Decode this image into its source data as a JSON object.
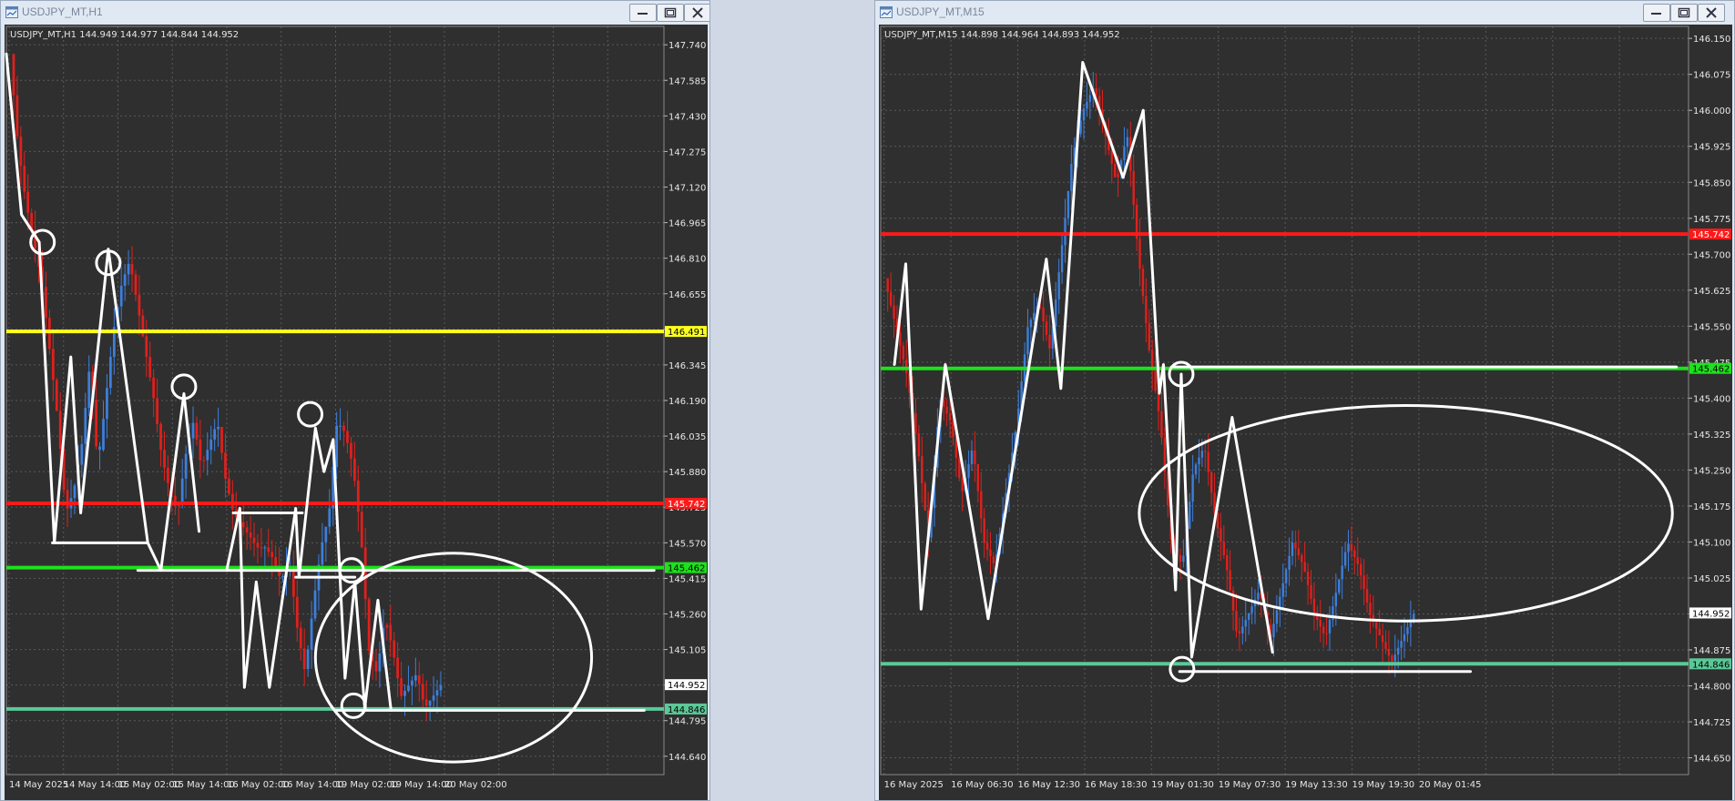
{
  "colors": {
    "bg": "#2f2f2f",
    "grid": "#5a5a5a",
    "axis_text": "#e6e6e6",
    "bull": "#3c7fdc",
    "bear": "#e0201c",
    "drawing": "#ffffff",
    "red_level": "#ff1a1a",
    "green_level": "#1ee11e",
    "teal_level": "#5cc898",
    "yellow_level": "#ffff1e"
  },
  "windows": [
    {
      "title": "USDJPY_MT,H1",
      "minimize_icon": "minimize-icon",
      "maximize_icon": "maximize-icon",
      "close_icon": "close-icon",
      "chart_data": {
        "type": "candlestick",
        "info_label": "USDJPY_MT,H1  144.949 144.977 144.844 144.952",
        "ylim": [
          144.56,
          147.82
        ],
        "y_ticks": [
          "147.740",
          "147.585",
          "147.430",
          "147.275",
          "147.120",
          "146.965",
          "146.810",
          "146.655",
          "146.500",
          "146.345",
          "146.190",
          "146.035",
          "145.880",
          "145.725",
          "145.570",
          "145.415",
          "145.260",
          "145.105",
          "144.950",
          "144.795",
          "144.640"
        ],
        "x_ticks": [
          "14 May 2025",
          "14 May 14:00",
          "15 May 02:00",
          "15 May 14:00",
          "16 May 02:00",
          "16 May 14:00",
          "19 May 02:00",
          "19 May 14:00",
          "20 May 02:00"
        ],
        "levels": [
          {
            "value": 146.491,
            "label": "146.491",
            "color": "#ffff1e"
          },
          {
            "value": 145.742,
            "label": "145.742",
            "color": "#ff1a1a"
          },
          {
            "value": 145.462,
            "label": "145.462",
            "color": "#1ee11e"
          },
          {
            "value": 144.846,
            "label": "144.846",
            "color": "#5cc898"
          }
        ],
        "current_price": "144.952",
        "current_value": 144.952,
        "candle_count": 120,
        "close_path": [
          147.7,
          147.3,
          147.05,
          146.88,
          146.7,
          146.4,
          146.1,
          145.7,
          145.8,
          146.0,
          146.35,
          145.9,
          146.2,
          146.5,
          146.7,
          146.8,
          146.6,
          146.4,
          146.2,
          145.95,
          145.8,
          145.7,
          145.95,
          146.1,
          145.9,
          146.0,
          146.1,
          145.85,
          145.7,
          145.65,
          145.6,
          145.55,
          145.55,
          145.5,
          145.4,
          145.5,
          145.2,
          145.0,
          145.3,
          145.55,
          145.7,
          146.1,
          146.05,
          145.9,
          145.6,
          145.1,
          145.0,
          145.25,
          145.1,
          144.9,
          144.95,
          145.0,
          144.85,
          144.9,
          144.95
        ],
        "drawings": {
          "zigzags": [
            [
              [
                0.0,
                147.7
              ],
              [
                0.023,
                147.0
              ],
              [
                0.05,
                146.88
              ],
              [
                0.073,
                145.57
              ],
              [
                0.098,
                146.38
              ],
              [
                0.113,
                145.7
              ],
              [
                0.155,
                146.85
              ],
              [
                0.215,
                145.57
              ],
              [
                0.235,
                145.45
              ],
              [
                0.27,
                146.22
              ],
              [
                0.293,
                145.62
              ]
            ],
            [
              [
                0.335,
                145.45
              ],
              [
                0.355,
                145.72
              ],
              [
                0.362,
                144.94
              ],
              [
                0.38,
                145.4
              ],
              [
                0.4,
                144.94
              ],
              [
                0.44,
                145.72
              ],
              [
                0.445,
                145.42
              ],
              [
                0.47,
                146.07
              ],
              [
                0.483,
                145.88
              ],
              [
                0.497,
                146.02
              ],
              [
                0.515,
                144.98
              ],
              [
                0.53,
                145.4
              ],
              [
                0.545,
                144.85
              ],
              [
                0.565,
                145.32
              ],
              [
                0.585,
                144.84
              ]
            ]
          ],
          "hlines": [
            [
              0.07,
              0.215,
              145.57
            ],
            [
              0.2,
              0.985,
              145.45
            ],
            [
              0.345,
              0.45,
              145.7
            ],
            [
              0.44,
              0.53,
              145.42
            ],
            [
              0.5,
              0.97,
              144.84
            ]
          ],
          "circles": [
            [
              0.055,
              146.88
            ],
            [
              0.155,
              146.79
            ],
            [
              0.27,
              146.25
            ],
            [
              0.462,
              146.13
            ],
            [
              0.525,
              145.45
            ],
            [
              0.528,
              144.86
            ]
          ],
          "ellipses": [
            [
              0.68,
              145.07,
              0.21,
              0.31
            ]
          ]
        }
      }
    },
    {
      "title": "USDJPY_MT,M15",
      "minimize_icon": "minimize-icon",
      "maximize_icon": "maximize-icon",
      "close_icon": "close-icon",
      "chart_data": {
        "type": "candlestick",
        "info_label": "USDJPY_MT,M15  144.898 144.964 144.893 144.952",
        "ylim": [
          144.615,
          146.175
        ],
        "y_ticks": [
          "146.150",
          "146.075",
          "146.000",
          "145.925",
          "145.850",
          "145.775",
          "145.700",
          "145.625",
          "145.550",
          "145.475",
          "145.400",
          "145.325",
          "145.250",
          "145.175",
          "145.100",
          "145.025",
          "144.950",
          "144.875",
          "144.800",
          "144.725",
          "144.650"
        ],
        "x_ticks": [
          "16 May 2025",
          "16 May 06:30",
          "16 May 12:30",
          "16 May 18:30",
          "19 May 01:30",
          "19 May 07:30",
          "19 May 13:30",
          "19 May 19:30",
          "20 May 01:45"
        ],
        "levels": [
          {
            "value": 145.742,
            "label": "145.742",
            "color": "#ff1a1a"
          },
          {
            "value": 145.462,
            "label": "145.462",
            "color": "#1ee11e"
          },
          {
            "value": 144.846,
            "label": "144.846",
            "color": "#5cc898"
          }
        ],
        "current_price": "144.952",
        "current_value": 144.952,
        "candle_count": 170,
        "close_path": [
          145.65,
          145.55,
          145.45,
          145.3,
          145.1,
          145.4,
          145.35,
          145.2,
          145.3,
          145.1,
          145.05,
          145.2,
          145.35,
          145.55,
          145.6,
          145.5,
          145.7,
          145.9,
          146.0,
          146.05,
          145.95,
          145.85,
          145.95,
          145.7,
          145.5,
          145.35,
          145.1,
          145.05,
          145.25,
          145.3,
          145.15,
          145.05,
          144.9,
          144.95,
          145.0,
          144.9,
          145.0,
          145.1,
          145.05,
          144.95,
          144.9,
          145.0,
          145.1,
          145.05,
          144.95,
          144.9,
          144.85,
          144.9,
          144.95
        ],
        "drawings": {
          "zigzags": [
            [
              [
                0.017,
                145.47
              ],
              [
                0.031,
                145.68
              ],
              [
                0.05,
                144.96
              ],
              [
                0.08,
                145.47
              ],
              [
                0.133,
                144.94
              ],
              [
                0.205,
                145.69
              ],
              [
                0.223,
                145.42
              ],
              [
                0.25,
                146.1
              ],
              [
                0.3,
                145.86
              ],
              [
                0.325,
                146.0
              ],
              [
                0.345,
                145.41
              ],
              [
                0.35,
                145.47
              ],
              [
                0.365,
                145.0
              ],
              [
                0.372,
                145.45
              ],
              [
                0.385,
                144.86
              ],
              [
                0.435,
                145.36
              ],
              [
                0.485,
                144.87
              ]
            ]
          ],
          "hlines": [
            [
              0.36,
              0.985,
              145.465
            ],
            [
              0.37,
              0.73,
              144.83
            ]
          ],
          "circles": [
            [
              0.372,
              145.45
            ],
            [
              0.373,
              144.835
            ]
          ],
          "ellipses": [
            [
              0.65,
              145.16,
              0.33,
              0.32
            ]
          ]
        }
      }
    }
  ]
}
